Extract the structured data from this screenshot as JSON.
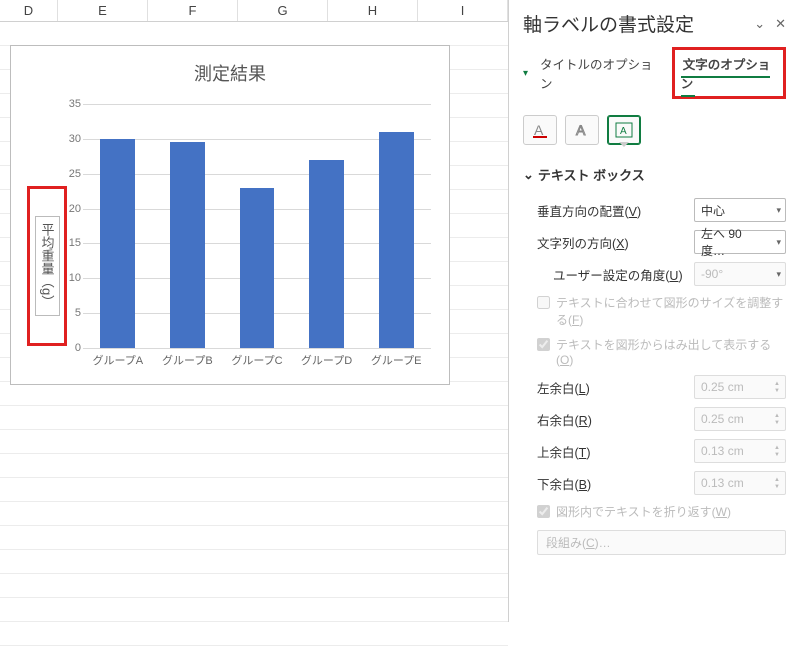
{
  "columns": [
    "D",
    "E",
    "F",
    "G",
    "H",
    "I"
  ],
  "chart_data": {
    "type": "bar",
    "title": "測定結果",
    "ylabel": "平均重量（g）",
    "categories": [
      "グループA",
      "グループB",
      "グループC",
      "グループD",
      "グループE"
    ],
    "values": [
      30,
      29.5,
      23,
      27,
      31
    ],
    "ylim": [
      0,
      35
    ],
    "yticks": [
      0,
      5,
      10,
      15,
      20,
      25,
      30,
      35
    ]
  },
  "pane": {
    "title": "軸ラベルの書式設定",
    "tabs": {
      "title_options": "タイトルのオプション",
      "text_options": "文字のオプション"
    },
    "section": "テキスト ボックス",
    "fields": {
      "valign_label": "垂直方向の配置(<u>V</u>)",
      "valign_value": "中心",
      "direction_label": "文字列の方向(<u>X</u>)",
      "direction_value": "左へ 90 度…",
      "custom_angle_label": "ユーザー設定の角度(<u>U</u>)",
      "custom_angle_value": "-90°",
      "resize_label": "テキストに合わせて図形のサイズを調整する(<u>F</u>)",
      "overflow_label": "テキストを図形からはみ出して表示する(<u>O</u>)",
      "margin_left_label": "左余白(<u>L</u>)",
      "margin_left_value": "0.25 cm",
      "margin_right_label": "右余白(<u>R</u>)",
      "margin_right_value": "0.25 cm",
      "margin_top_label": "上余白(<u>T</u>)",
      "margin_top_value": "0.13 cm",
      "margin_bottom_label": "下余白(<u>B</u>)",
      "margin_bottom_value": "0.13 cm",
      "wrap_label": "図形内でテキストを折り返す(<u>W</u>)",
      "columns_btn": "段組み(<u>C</u>)…"
    }
  }
}
